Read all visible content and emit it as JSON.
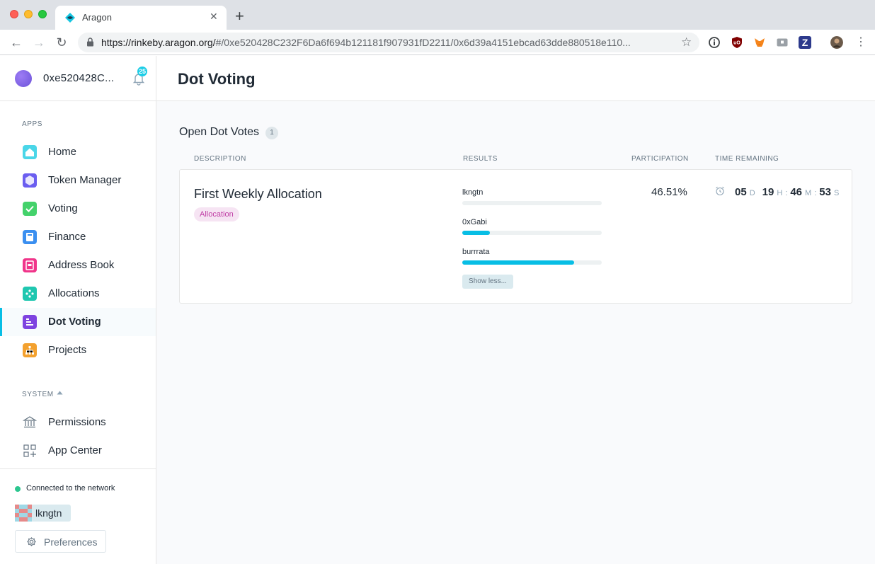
{
  "browser": {
    "tab_title": "Aragon",
    "tab_close": "✕",
    "new_tab": "+",
    "url_host": "https://rinkeby.aragon.org/",
    "url_path": "#/0xe520428C232F6Da6f694b121181f907931fD2211/0x6d39a4151ebcad63dde880518e110...",
    "extensions": [
      {
        "name": "info",
        "color": "#5f6368"
      },
      {
        "name": "ublock",
        "color": "#800000",
        "label": "uO"
      },
      {
        "name": "metamask",
        "color": "#f6851b"
      },
      {
        "name": "cast",
        "color": "#9aa0a6"
      },
      {
        "name": "zotero",
        "color": "#2d3a8c",
        "label": "Z"
      }
    ]
  },
  "account": {
    "address": "0xe520428C...",
    "notification_count": "25"
  },
  "apps_label": "APPS",
  "apps": [
    {
      "label": "Home",
      "icon": "home-icon",
      "color": "#4ad6e8",
      "active": false
    },
    {
      "label": "Token Manager",
      "icon": "token-manager-icon",
      "color": "#6b5ef0",
      "active": false
    },
    {
      "label": "Voting",
      "icon": "voting-icon",
      "color": "#44d26b",
      "active": false
    },
    {
      "label": "Finance",
      "icon": "finance-icon",
      "color": "#3a8ff0",
      "active": false
    },
    {
      "label": "Address Book",
      "icon": "address-book-icon",
      "color": "#f0358a",
      "active": false
    },
    {
      "label": "Allocations",
      "icon": "allocations-icon",
      "color": "#1fc7b0",
      "active": false
    },
    {
      "label": "Dot Voting",
      "icon": "dot-voting-icon",
      "color": "#7e43e0",
      "active": true
    },
    {
      "label": "Projects",
      "icon": "projects-icon",
      "color": "#f3a12f",
      "active": false
    }
  ],
  "system_label": "SYSTEM",
  "system": [
    {
      "label": "Permissions",
      "icon": "bank-icon"
    },
    {
      "label": "App Center",
      "icon": "app-center-icon"
    }
  ],
  "footer": {
    "network_status": "Connected to the network",
    "user": "lkngtn",
    "preferences_label": "Preferences"
  },
  "main": {
    "title": "Dot Voting",
    "section_title": "Open Dot Votes",
    "section_count": "1",
    "columns": {
      "description": "DESCRIPTION",
      "results": "RESULTS",
      "participation": "PARTICIPATION",
      "time_remaining": "TIME REMAINING"
    },
    "votes": [
      {
        "description": "First Weekly Allocation",
        "tag": "Allocation",
        "results": [
          {
            "label": "lkngtn",
            "fraction": 0.0
          },
          {
            "label": "0xGabi",
            "fraction": 0.2
          },
          {
            "label": "burrrata",
            "fraction": 0.8
          }
        ],
        "show_less_label": "Show less...",
        "participation": "46.51%",
        "time": {
          "days": "05",
          "days_unit": "D",
          "hours": "19",
          "hours_unit": "H",
          "minutes": "46",
          "minutes_unit": "M",
          "seconds": "53",
          "seconds_unit": "S",
          "separator": ":"
        }
      }
    ]
  },
  "colors": {
    "accent": "#08bee5",
    "tag_bg": "#f6e4f3",
    "tag_text": "#c03ea5",
    "network_ok": "#2cc68f"
  }
}
